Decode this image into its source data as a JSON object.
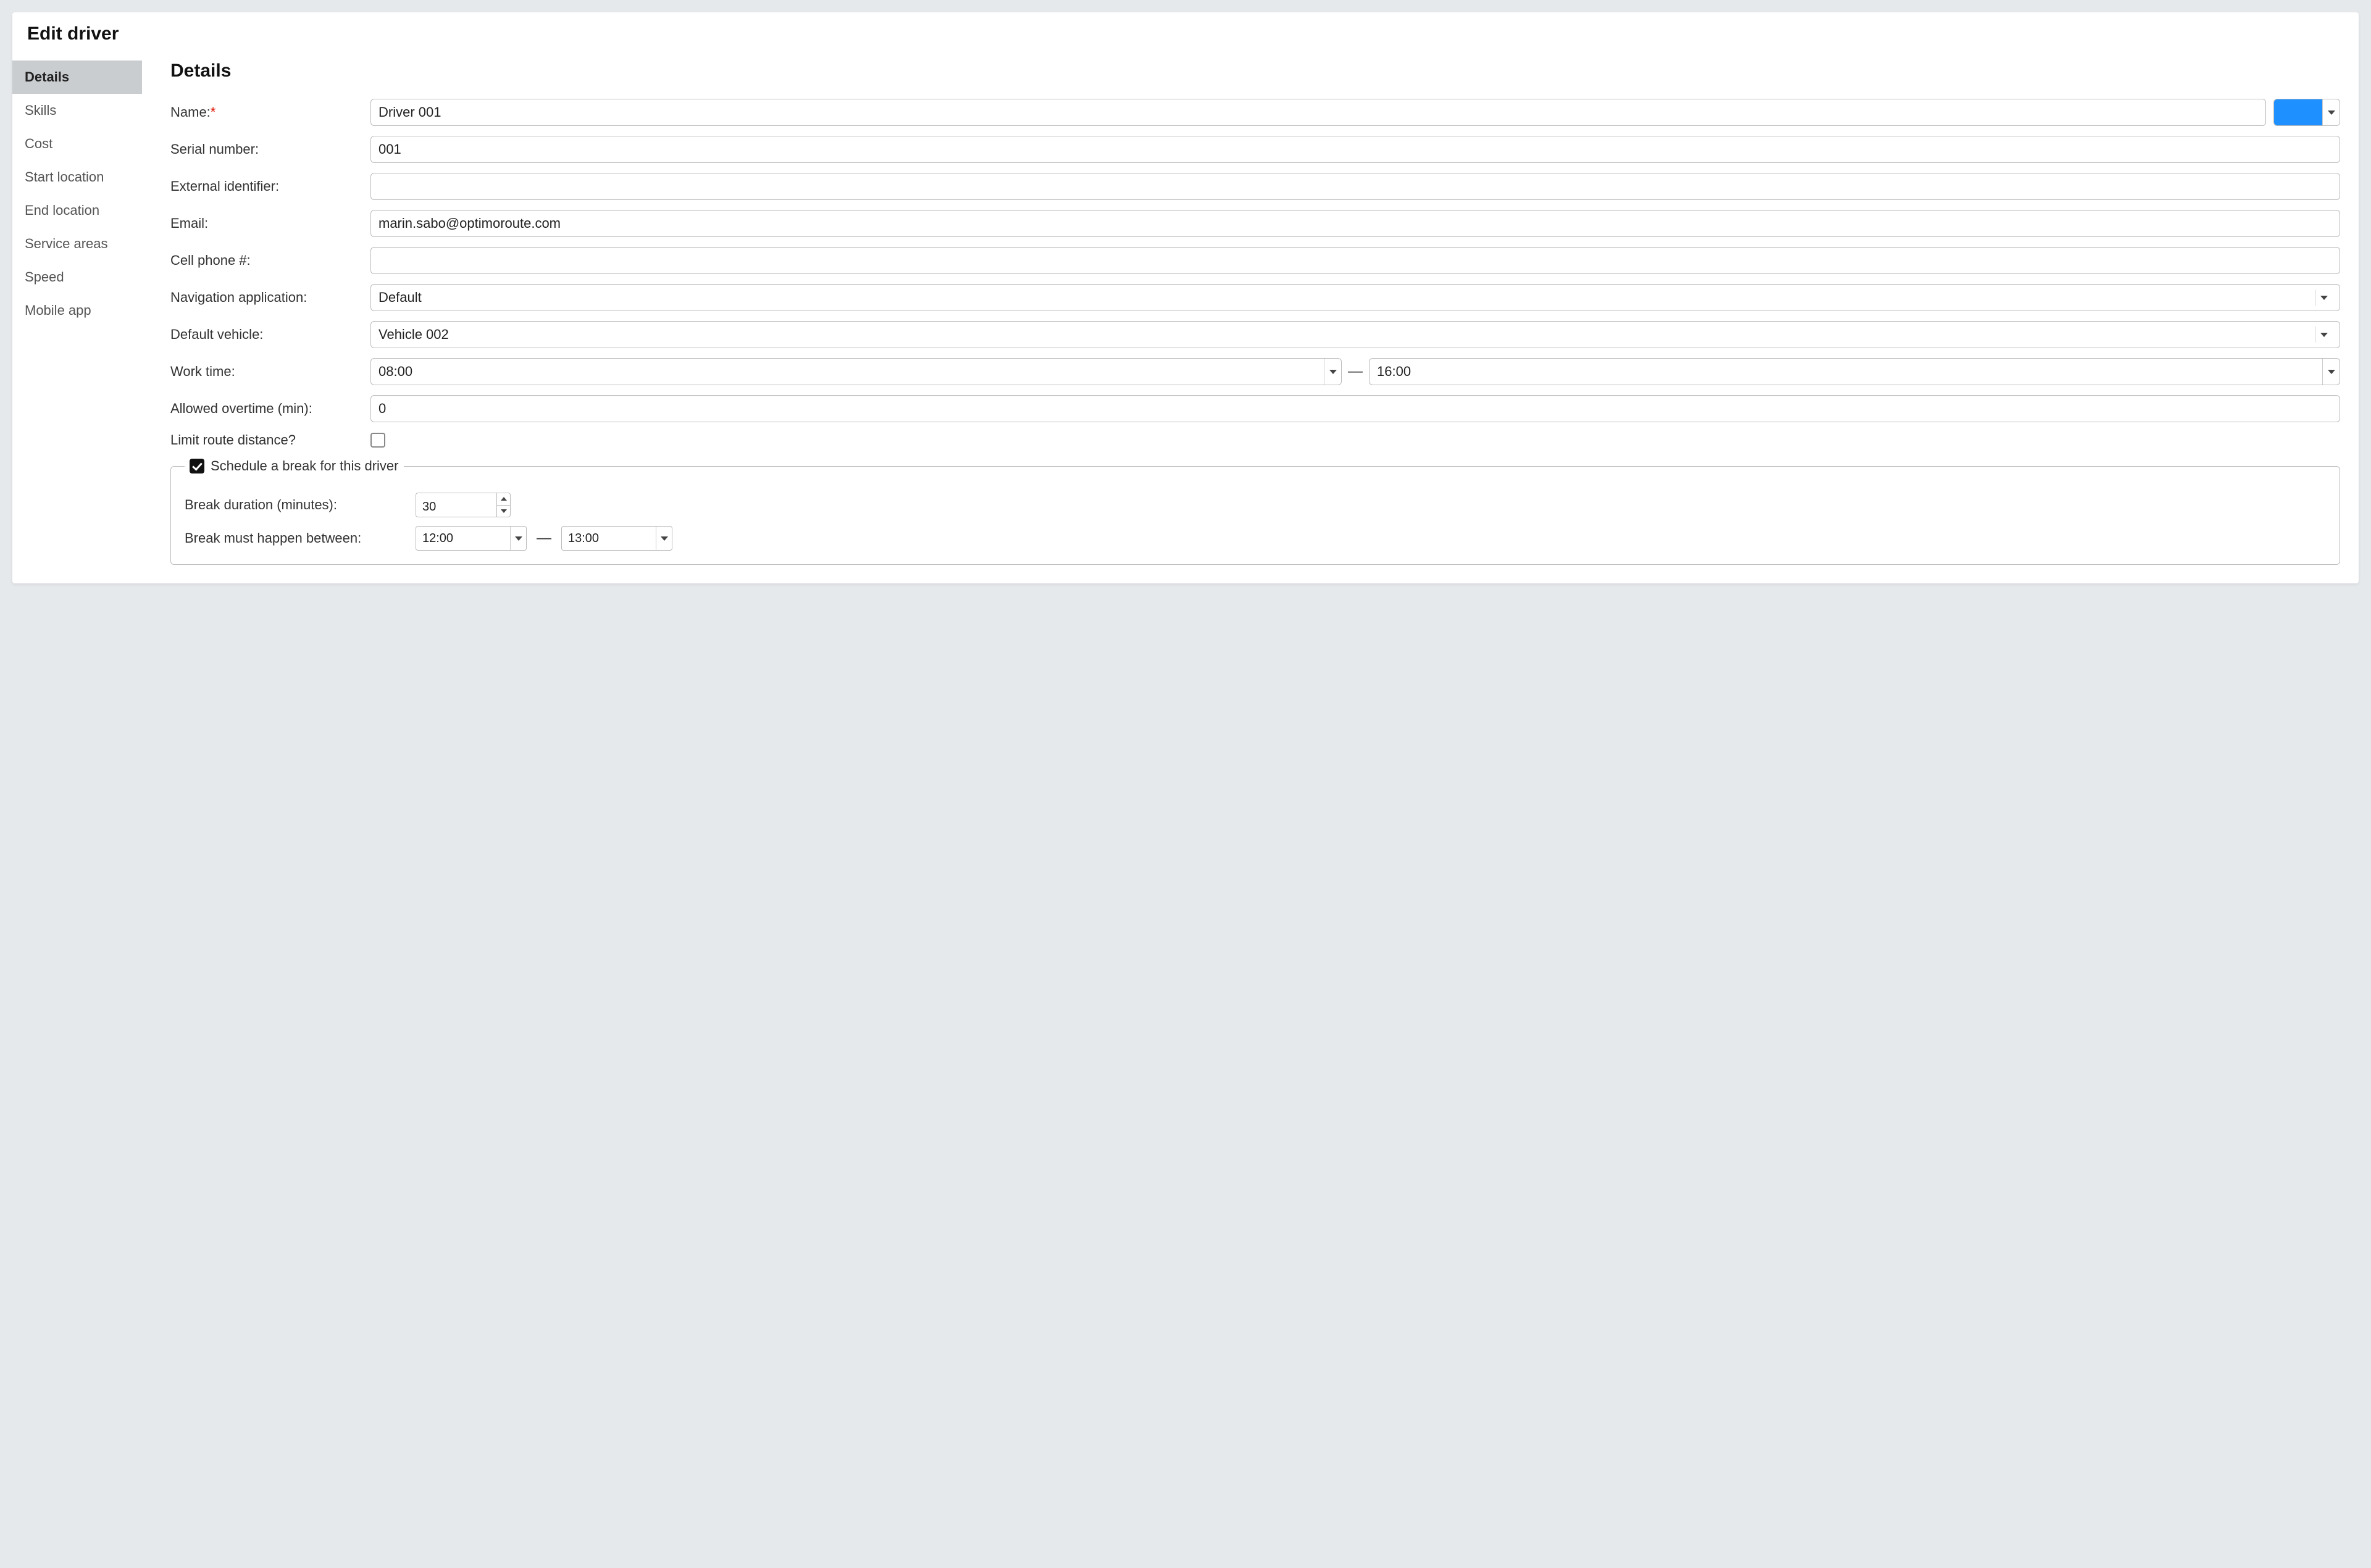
{
  "title": "Edit driver",
  "sidebar": {
    "items": [
      {
        "label": "Details",
        "active": true
      },
      {
        "label": "Skills",
        "active": false
      },
      {
        "label": "Cost",
        "active": false
      },
      {
        "label": "Start location",
        "active": false
      },
      {
        "label": "End location",
        "active": false
      },
      {
        "label": "Service areas",
        "active": false
      },
      {
        "label": "Speed",
        "active": false
      },
      {
        "label": "Mobile app",
        "active": false
      }
    ]
  },
  "main": {
    "heading": "Details",
    "fields": {
      "name": {
        "label": "Name:",
        "required": true,
        "value": "Driver 001"
      },
      "color": {
        "value": "#1e90ff"
      },
      "serial": {
        "label": "Serial number:",
        "value": "001"
      },
      "external_id": {
        "label": "External identifier:",
        "value": ""
      },
      "email": {
        "label": "Email:",
        "value": "marin.sabo@optimoroute.com"
      },
      "cellphone": {
        "label": "Cell phone #:",
        "value": ""
      },
      "nav_app": {
        "label": "Navigation application:",
        "value": "Default"
      },
      "default_vehicle": {
        "label": "Default vehicle:",
        "value": "Vehicle 002"
      },
      "work_time": {
        "label": "Work time:",
        "from": "08:00",
        "to": "16:00"
      },
      "allowed_overtime": {
        "label": "Allowed overtime (min):",
        "value": "0"
      },
      "limit_distance": {
        "label": "Limit route distance?",
        "checked": false
      }
    },
    "break": {
      "legend": "Schedule a break for this driver",
      "checked": true,
      "duration": {
        "label": "Break duration (minutes):",
        "value": "30"
      },
      "window": {
        "label": "Break must happen between:",
        "from": "12:00",
        "to": "13:00"
      }
    }
  },
  "glyphs": {
    "required": "*",
    "dash": "—"
  }
}
